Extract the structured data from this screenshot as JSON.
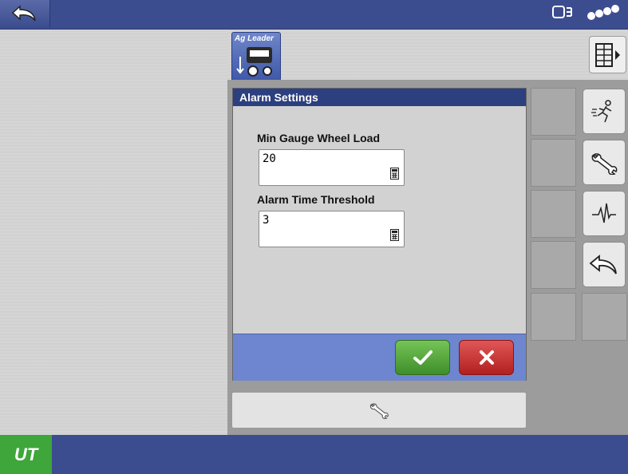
{
  "brand": {
    "name": "Ag Leader"
  },
  "bottom_logo": {
    "text": "UT"
  },
  "dialog": {
    "title": "Alarm Settings",
    "fields": [
      {
        "label": "Min Gauge Wheel Load",
        "value": "20"
      },
      {
        "label": "Alarm Time Threshold",
        "value": "3"
      }
    ]
  },
  "icons": {
    "back": "back-arrow-icon",
    "display": "display-icon",
    "signal": "signal-icon",
    "grid": "grid-menu-icon",
    "run": "running-man-icon",
    "wrench": "wrench-icon",
    "diagnostics": "heartbeat-icon",
    "return": "return-arrow-icon",
    "ok": "checkmark-icon",
    "cancel": "x-icon",
    "calculator": "calculator-icon"
  },
  "colors": {
    "topbar": "#3c4d8f",
    "dialog_title": "#2c3f7e",
    "ok": "#4fa33a",
    "cancel": "#c92a2a",
    "ut_logo": "#3ea63a"
  }
}
